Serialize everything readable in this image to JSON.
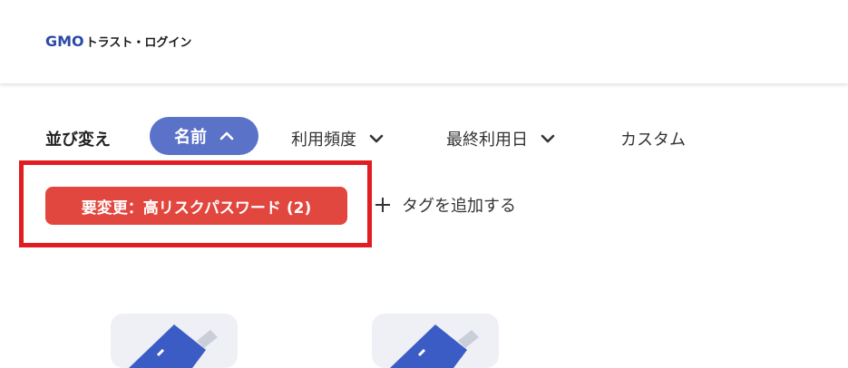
{
  "header": {
    "logo_brand": "GMO",
    "logo_product": "トラスト・ログイン"
  },
  "sort": {
    "label": "並び変え",
    "active": {
      "label": "名前",
      "icon": "chevron-up-icon"
    },
    "options": [
      {
        "label": "利用頻度",
        "icon": "chevron-down-icon"
      },
      {
        "label": "最終利用日",
        "icon": "chevron-down-icon"
      },
      {
        "label": "カスタム"
      }
    ]
  },
  "tags": {
    "active_tag": "要変更：高リスクパスワード (2)",
    "add_tag_label": "タグを追加する",
    "add_icon": "plus-icon"
  },
  "colors": {
    "brand_blue": "#2b4aa8",
    "active_pill": "#5a72c8",
    "tag_red": "#e2473f",
    "highlight_border": "#e11d21"
  },
  "cards": [
    {
      "icon": "app-icon"
    },
    {
      "icon": "app-icon"
    }
  ]
}
